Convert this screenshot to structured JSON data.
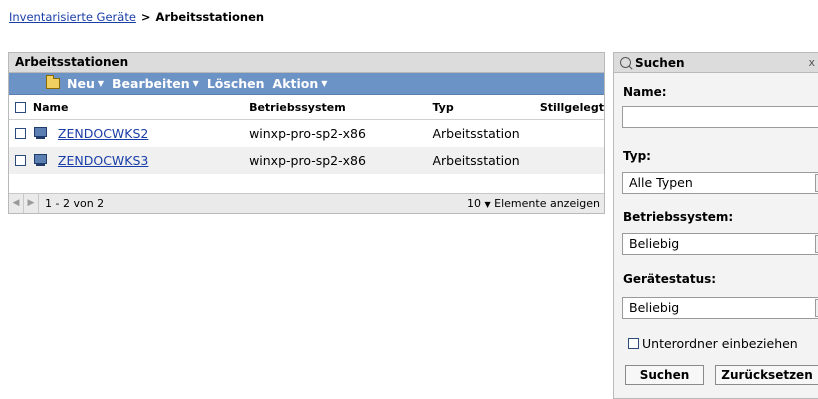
{
  "breadcrumb": {
    "link": "Inventarisierte Geräte",
    "separator": ">",
    "current": "Arbeitsstationen"
  },
  "panel": {
    "title": "Arbeitsstationen",
    "toolbar": {
      "new": "Neu",
      "edit": "Bearbeiten",
      "delete": "Löschen",
      "action": "Aktion"
    },
    "columns": {
      "name": "Name",
      "os": "Betriebssystem",
      "type": "Typ",
      "retired": "Stillgelegt"
    },
    "rows": [
      {
        "name": "ZENDOCWKS2",
        "os": "winxp-pro-sp2-x86",
        "type": "Arbeitsstation",
        "retired": ""
      },
      {
        "name": "ZENDOCWKS3",
        "os": "winxp-pro-sp2-x86",
        "type": "Arbeitsstation",
        "retired": ""
      }
    ],
    "pager": {
      "range": "1 - 2 von 2",
      "per_page": "10",
      "per_page_label": "Elemente anzeigen"
    }
  },
  "search": {
    "title": "Suchen",
    "close": "x",
    "name_label": "Name:",
    "name_value": "",
    "type_label": "Typ:",
    "type_value": "Alle Typen",
    "os_label": "Betriebssystem:",
    "os_value": "Beliebig",
    "status_label": "Gerätestatus:",
    "status_value": "Beliebig",
    "subfolders_label": "Unterordner einbeziehen",
    "search_button": "Suchen",
    "reset_button": "Zurücksetzen"
  },
  "colors": {
    "toolbar": "#6c93c6",
    "link": "#1a3ea8",
    "header": "#dcdcdc"
  }
}
